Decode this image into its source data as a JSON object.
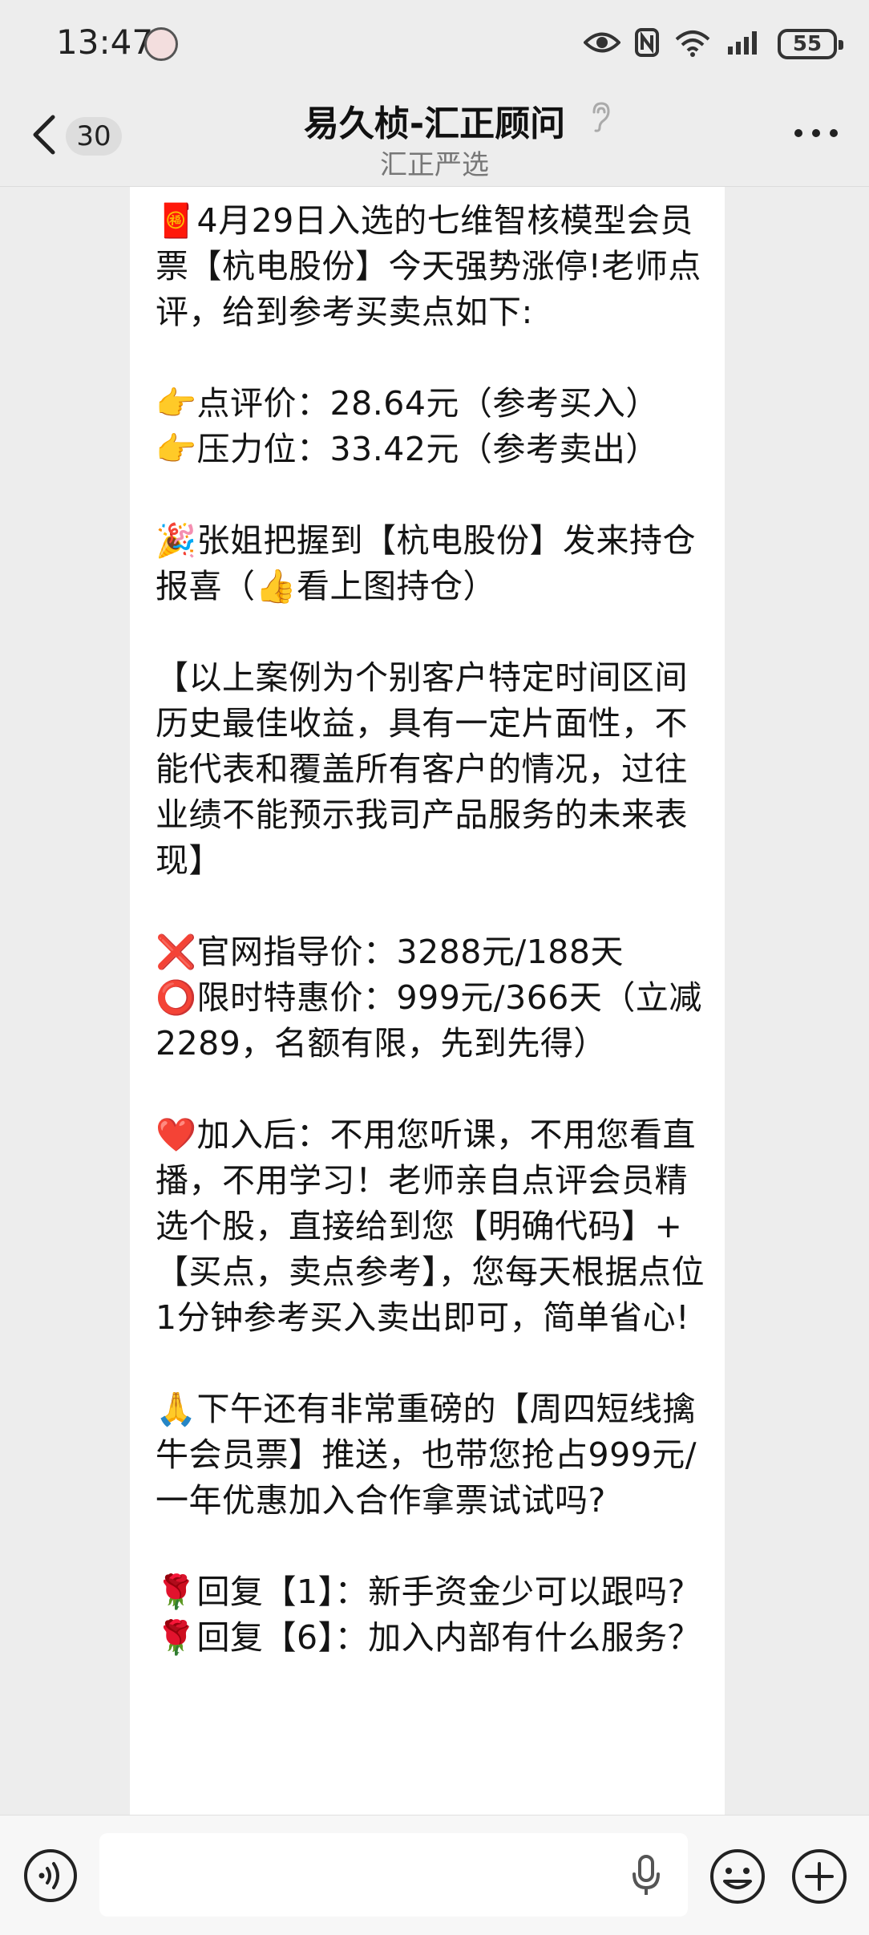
{
  "status_bar": {
    "time": "13:47",
    "battery": "55"
  },
  "header": {
    "back_label": "",
    "unread_count": "30",
    "title": "易久桢-汇正顾问",
    "subtitle": "汇正严选",
    "more_label": "..."
  },
  "message": {
    "text": "🧧4月29日入选的七维智核模型会员票【杭电股份】今天强势涨停!老师点评，给到参考买卖点如下:\n\n👉点评价：28.64元（参考买入）\n👉压力位：33.42元（参考卖出）\n\n🎉张姐把握到【杭电股份】发来持仓报喜（👍看上图持仓）\n\n【以上案例为个别客户特定时间区间历史最佳收益，具有一定片面性，不能代表和覆盖所有客户的情况，过往业绩不能预示我司产品服务的未来表现】\n\n❌官网指导价：3288元/188天\n⭕限时特惠价：999元/366天（立减2289，名额有限，先到先得）\n\n❤️加入后：不用您听课，不用您看直播，不用学习！老师亲自点评会员精选个股，直接给到您【明确代码】+【买点，卖点参考】，您每天根据点位1分钟参考买入卖出即可，简单省心!\n\n🙏下午还有非常重磅的【周四短线擒牛会员票】推送，也带您抢占999元/一年优惠加入合作拿票试试吗?\n\n🌹回复【1】：新手资金少可以跟吗?\n🌹回复【6】：加入内部有什么服务？"
  },
  "input_bar": {
    "placeholder": ""
  },
  "colors": {
    "background": "#ededed",
    "bubble": "#ffffff",
    "text": "#141414"
  },
  "icons": {
    "back": "chevron-left-icon",
    "ear": "ear-icon",
    "more": "more-dots-icon",
    "voice": "voice-icon",
    "mic": "mic-icon",
    "emoji": "emoji-icon",
    "plus": "plus-icon"
  }
}
